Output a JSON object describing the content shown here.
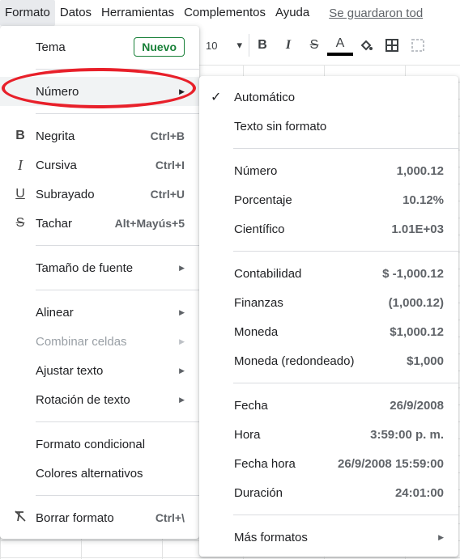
{
  "menubar": {
    "items": [
      "Formato",
      "Datos",
      "Herramientas",
      "Complementos",
      "Ayuda"
    ],
    "saved_status": "Se guardaron tod"
  },
  "toolbar": {
    "font_size": "10",
    "bold": "B",
    "italic": "I",
    "strike": "S",
    "text_color": "A"
  },
  "format_menu": {
    "tema": {
      "label": "Tema",
      "badge": "Nuevo"
    },
    "numero": {
      "label": "Número"
    },
    "negrita": {
      "label": "Negrita",
      "shortcut": "Ctrl+B"
    },
    "cursiva": {
      "label": "Cursiva",
      "shortcut": "Ctrl+I"
    },
    "subrayado": {
      "label": "Subrayado",
      "shortcut": "Ctrl+U"
    },
    "tachar": {
      "label": "Tachar",
      "shortcut": "Alt+Mayús+5"
    },
    "tamano": {
      "label": "Tamaño de fuente"
    },
    "alinear": {
      "label": "Alinear"
    },
    "combinar": {
      "label": "Combinar celdas"
    },
    "ajustar": {
      "label": "Ajustar texto"
    },
    "rotacion": {
      "label": "Rotación de texto"
    },
    "condicional": {
      "label": "Formato condicional"
    },
    "alternativos": {
      "label": "Colores alternativos"
    },
    "borrar": {
      "label": "Borrar formato",
      "shortcut": "Ctrl+\\"
    }
  },
  "number_menu": {
    "automatico": {
      "label": "Automático"
    },
    "texto": {
      "label": "Texto sin formato"
    },
    "numero": {
      "label": "Número",
      "value": "1,000.12"
    },
    "porcentaje": {
      "label": "Porcentaje",
      "value": "10.12%"
    },
    "cientifico": {
      "label": "Científico",
      "value": "1.01E+03"
    },
    "contabilidad": {
      "label": "Contabilidad",
      "value": "$ -1,000.12"
    },
    "finanzas": {
      "label": "Finanzas",
      "value": "(1,000.12)"
    },
    "moneda": {
      "label": "Moneda",
      "value": "$1,000.12"
    },
    "moneda_red": {
      "label": "Moneda (redondeado)",
      "value": "$1,000"
    },
    "fecha": {
      "label": "Fecha",
      "value": "26/9/2008"
    },
    "hora": {
      "label": "Hora",
      "value": "3:59:00 p. m."
    },
    "fecha_hora": {
      "label": "Fecha hora",
      "value": "26/9/2008 15:59:00"
    },
    "duracion": {
      "label": "Duración",
      "value": "24:01:00"
    },
    "mas": {
      "label": "Más formatos"
    }
  },
  "colors": {
    "highlight_oval": "#e8202a",
    "badge": "#188038"
  }
}
